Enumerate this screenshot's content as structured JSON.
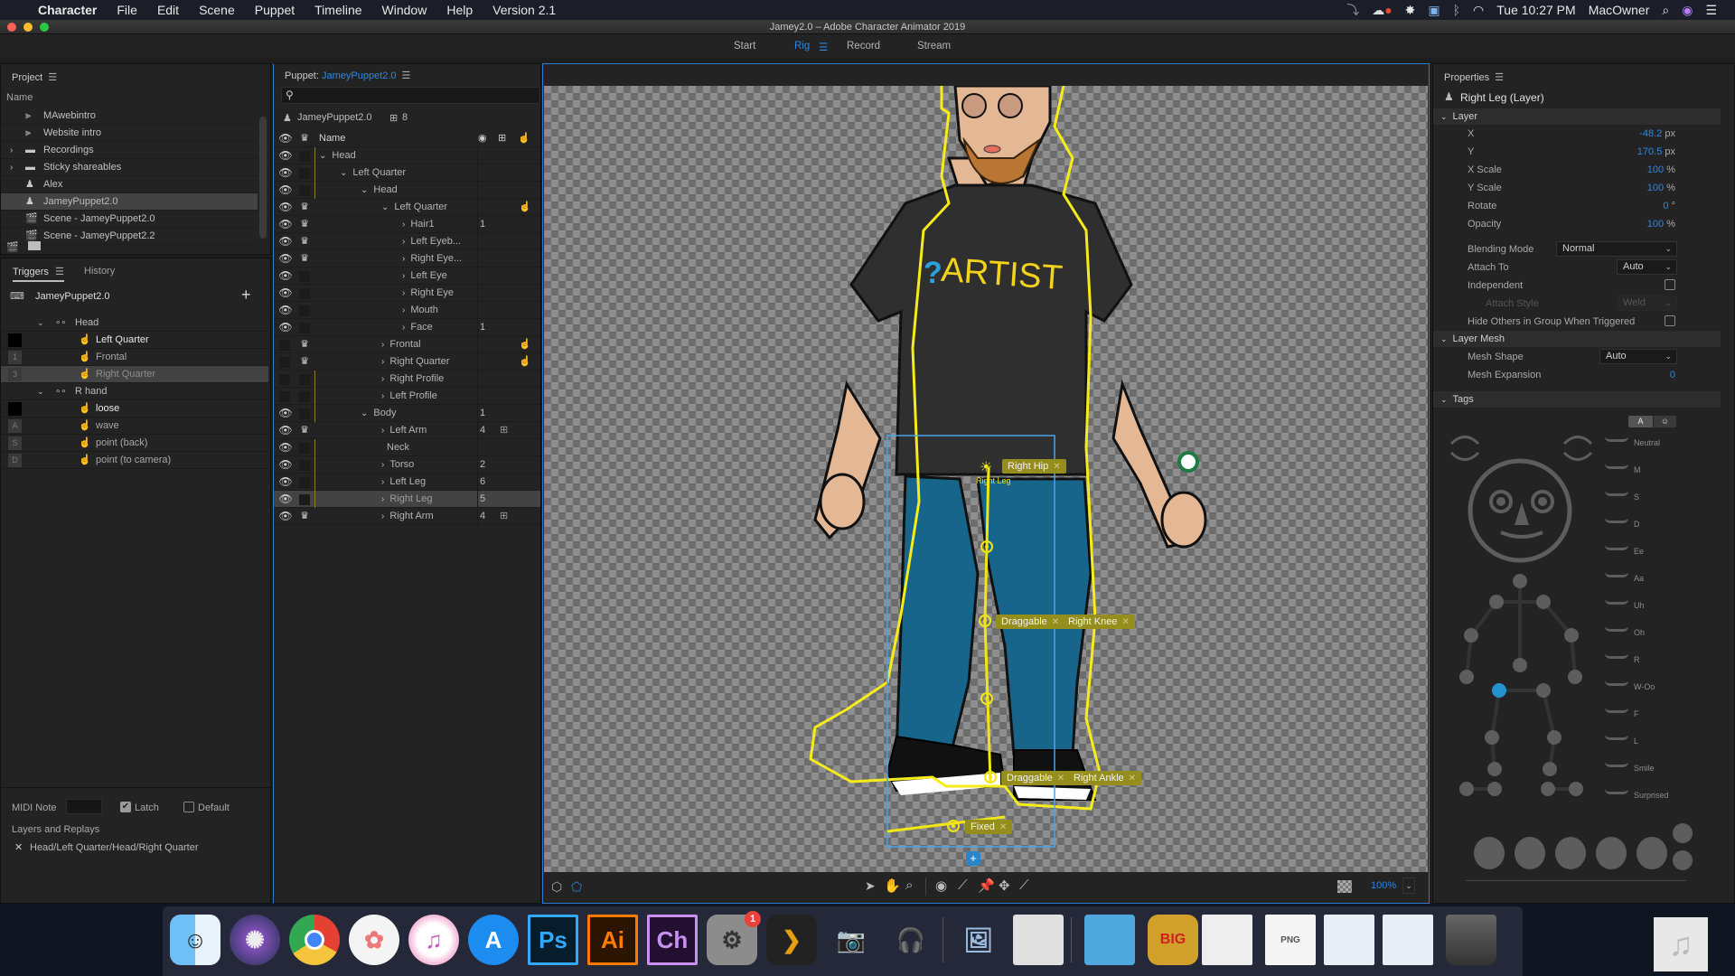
{
  "menubar": {
    "app": "Character",
    "items": [
      "File",
      "Edit",
      "Scene",
      "Puppet",
      "Timeline",
      "Window",
      "Help",
      "Version 2.1"
    ],
    "clock": "Tue 10:27 PM",
    "user": "MacOwner"
  },
  "window": {
    "title": "Jamey2.0 – Adobe Character Animator 2019",
    "workspace_tabs": [
      {
        "label": "Start",
        "active": false
      },
      {
        "label": "Rig",
        "active": true
      },
      {
        "label": "Record",
        "active": false
      },
      {
        "label": "Stream",
        "active": false
      }
    ]
  },
  "project": {
    "title": "Project",
    "column": "Name",
    "items": [
      {
        "label": "MAwebintro",
        "icon": "audio-icon",
        "expandable": false
      },
      {
        "label": "Website intro",
        "icon": "audio-icon",
        "expandable": false
      },
      {
        "label": "Recordings",
        "icon": "folder-icon",
        "expandable": true
      },
      {
        "label": "Sticky shareables",
        "icon": "folder-icon",
        "expandable": true
      },
      {
        "label": "Alex",
        "icon": "puppet-icon",
        "expandable": false
      },
      {
        "label": "JameyPuppet2.0",
        "icon": "puppet-icon",
        "expandable": false,
        "selected": true
      },
      {
        "label": "Scene - JameyPuppet2.0",
        "icon": "scene-icon",
        "expandable": false
      },
      {
        "label": "Scene - JameyPuppet2.2",
        "icon": "scene-icon",
        "expandable": false
      }
    ]
  },
  "triggers": {
    "tabs": [
      "Triggers",
      "History"
    ],
    "puppet": "JameyPuppet2.0",
    "groups": [
      {
        "label": "Head",
        "items": [
          {
            "key": "",
            "label": "Left Quarter",
            "active": true
          },
          {
            "key": "1",
            "label": "Frontal",
            "active": false
          },
          {
            "key": "3",
            "label": "Right Quarter",
            "active": false,
            "selected": true
          }
        ]
      },
      {
        "label": "R hand",
        "items": [
          {
            "key": "",
            "label": "loose",
            "active": true
          },
          {
            "key": "A",
            "label": "wave",
            "active": false
          },
          {
            "key": "S",
            "label": "point (back)",
            "active": false
          },
          {
            "key": "D",
            "label": "point (to camera)",
            "active": false
          }
        ]
      }
    ],
    "midi_note_label": "MIDI Note",
    "midi_note_value": "",
    "latch_label": "Latch",
    "latch_checked": true,
    "default_label": "Default",
    "default_checked": false,
    "layers_label": "Layers and Replays",
    "layer_path": "Head/Left Quarter/Head/Right Quarter"
  },
  "puppet_panel": {
    "title_prefix": "Puppet:",
    "title_name": "JameyPuppet2.0",
    "search_placeholder": "",
    "puppet_name": "JameyPuppet2.0",
    "behavior_count": "8",
    "column_name": "Name",
    "layers": [
      {
        "label": "Head",
        "depth": 0,
        "chev": "down",
        "eye": true,
        "crown": false,
        "num": "",
        "trig": false,
        "beh": false
      },
      {
        "label": "Left Quarter",
        "depth": 1,
        "chev": "down",
        "eye": true,
        "crown": false,
        "num": "",
        "trig": false,
        "beh": false
      },
      {
        "label": "Head",
        "depth": 2,
        "chev": "down",
        "eye": true,
        "crown": false,
        "num": "",
        "trig": false,
        "beh": false
      },
      {
        "label": "Left Quarter",
        "depth": 3,
        "chev": "down",
        "eye": true,
        "crown": true,
        "num": "",
        "trig": true,
        "beh": false
      },
      {
        "label": "Hair1",
        "depth": 4,
        "chev": "right",
        "eye": true,
        "crown": true,
        "num": "1",
        "trig": false,
        "beh": false
      },
      {
        "label": "Left Eyeb...",
        "depth": 4,
        "chev": "right",
        "eye": true,
        "crown": true,
        "num": "",
        "trig": false,
        "beh": false
      },
      {
        "label": "Right Eye...",
        "depth": 4,
        "chev": "right",
        "eye": true,
        "crown": true,
        "num": "",
        "trig": false,
        "beh": false
      },
      {
        "label": "Left Eye",
        "depth": 4,
        "chev": "right",
        "eye": true,
        "crown": false,
        "num": "",
        "trig": false,
        "beh": false
      },
      {
        "label": "Right Eye",
        "depth": 4,
        "chev": "right",
        "eye": true,
        "crown": false,
        "num": "",
        "trig": false,
        "beh": false
      },
      {
        "label": "Mouth",
        "depth": 4,
        "chev": "right",
        "eye": true,
        "crown": false,
        "num": "",
        "trig": false,
        "beh": false
      },
      {
        "label": "Face",
        "depth": 4,
        "chev": "right",
        "eye": true,
        "crown": false,
        "num": "1",
        "trig": false,
        "beh": false
      },
      {
        "label": "Frontal",
        "depth": 3,
        "chev": "right",
        "eye": false,
        "crown": true,
        "num": "",
        "trig": true,
        "beh": false
      },
      {
        "label": "Right Quarter",
        "depth": 3,
        "chev": "right",
        "eye": false,
        "crown": true,
        "num": "",
        "trig": true,
        "beh": false
      },
      {
        "label": "Right Profile",
        "depth": 3,
        "chev": "right",
        "eye": false,
        "crown": false,
        "num": "",
        "trig": false,
        "beh": false
      },
      {
        "label": "Left Profile",
        "depth": 3,
        "chev": "right",
        "eye": false,
        "crown": false,
        "num": "",
        "trig": false,
        "beh": false
      },
      {
        "label": "Body",
        "depth": 2,
        "chev": "down",
        "eye": true,
        "crown": false,
        "num": "1",
        "trig": false,
        "beh": false
      },
      {
        "label": "Left Arm",
        "depth": 3,
        "chev": "right",
        "eye": true,
        "crown": true,
        "num": "4",
        "trig": false,
        "beh": true
      },
      {
        "label": "Neck",
        "depth": 3,
        "chev": "",
        "eye": true,
        "crown": false,
        "num": "",
        "trig": false,
        "beh": false
      },
      {
        "label": "Torso",
        "depth": 3,
        "chev": "right",
        "eye": true,
        "crown": false,
        "num": "2",
        "trig": false,
        "beh": false
      },
      {
        "label": "Left Leg",
        "depth": 3,
        "chev": "right",
        "eye": true,
        "crown": false,
        "num": "6",
        "trig": false,
        "beh": false
      },
      {
        "label": "Right Leg",
        "depth": 3,
        "chev": "right",
        "eye": true,
        "crown": false,
        "num": "5",
        "trig": false,
        "beh": false,
        "selected": true
      },
      {
        "label": "Right Arm",
        "depth": 3,
        "chev": "right",
        "eye": true,
        "crown": true,
        "num": "4",
        "trig": false,
        "beh": true
      }
    ]
  },
  "canvas": {
    "shirt_text": "ARTIST",
    "layer_label": "Right Leg",
    "tags": [
      {
        "label": "Right Hip"
      },
      {
        "label": "Draggable"
      },
      {
        "label": "Right Knee"
      },
      {
        "label": "Draggable"
      },
      {
        "label": "Right Ankle"
      },
      {
        "label": "Fixed"
      }
    ],
    "zoom": "100%"
  },
  "properties": {
    "title": "Properties",
    "selection": "Right Leg (Layer)",
    "layer_section": "Layer",
    "fields": [
      {
        "label": "X",
        "value": "-48.2",
        "unit": "px"
      },
      {
        "label": "Y",
        "value": "170.5",
        "unit": "px"
      },
      {
        "label": "X Scale",
        "value": "100",
        "unit": "%"
      },
      {
        "label": "Y Scale",
        "value": "100",
        "unit": "%"
      },
      {
        "label": "Rotate",
        "value": "0",
        "unit": "°"
      },
      {
        "label": "Opacity",
        "value": "100",
        "unit": "%"
      }
    ],
    "blending_mode_label": "Blending Mode",
    "blending_mode": "Normal",
    "attach_to_label": "Attach To",
    "attach_to": "Auto",
    "independent_label": "Independent",
    "independent_checked": false,
    "attach_style_label": "Attach Style",
    "attach_style": "Weld",
    "hide_others_label": "Hide Others in Group When Triggered",
    "hide_others_checked": false,
    "mesh_section": "Layer Mesh",
    "mesh_shape_label": "Mesh Shape",
    "mesh_shape": "Auto",
    "mesh_expansion_label": "Mesh Expansion",
    "mesh_expansion": "0",
    "tags_section": "Tags",
    "tag_mode_a": "A",
    "mouth_tags": [
      "Neutral",
      "M",
      "S",
      "D",
      "Ee",
      "Aa",
      "Uh",
      "Oh",
      "R",
      "W-Oo",
      "F",
      "L",
      "Smile",
      "Surprised"
    ],
    "selected_body_tag": "Right Hip",
    "accent": "#2f86e0"
  },
  "dock": {
    "apps": [
      {
        "name": "Finder",
        "running": true
      },
      {
        "name": "Siri",
        "running": true
      },
      {
        "name": "Chrome",
        "running": true
      },
      {
        "name": "Photos",
        "running": true
      },
      {
        "name": "iTunes",
        "running": true
      },
      {
        "name": "App Store",
        "running": false
      },
      {
        "name": "Ps",
        "running": true
      },
      {
        "name": "Ai",
        "running": true
      },
      {
        "name": "Ch",
        "running": true
      },
      {
        "name": "System Preferences",
        "running": false,
        "badge": "1"
      },
      {
        "name": "Plex",
        "running": false
      },
      {
        "name": "Image Capture",
        "running": false
      },
      {
        "name": "Audacity",
        "running": true
      },
      {
        "name": "Preview",
        "running": true
      },
      {
        "name": "LibreOffice",
        "running": true
      },
      {
        "name": "Downloads",
        "running": false
      },
      {
        "name": "BIG",
        "running": false
      },
      {
        "name": "Document",
        "running": false
      },
      {
        "name": "PNG",
        "running": false
      },
      {
        "name": "Audacity doc 1",
        "running": false
      },
      {
        "name": "Audacity doc 2",
        "running": false
      },
      {
        "name": "Trash",
        "running": false
      }
    ]
  }
}
